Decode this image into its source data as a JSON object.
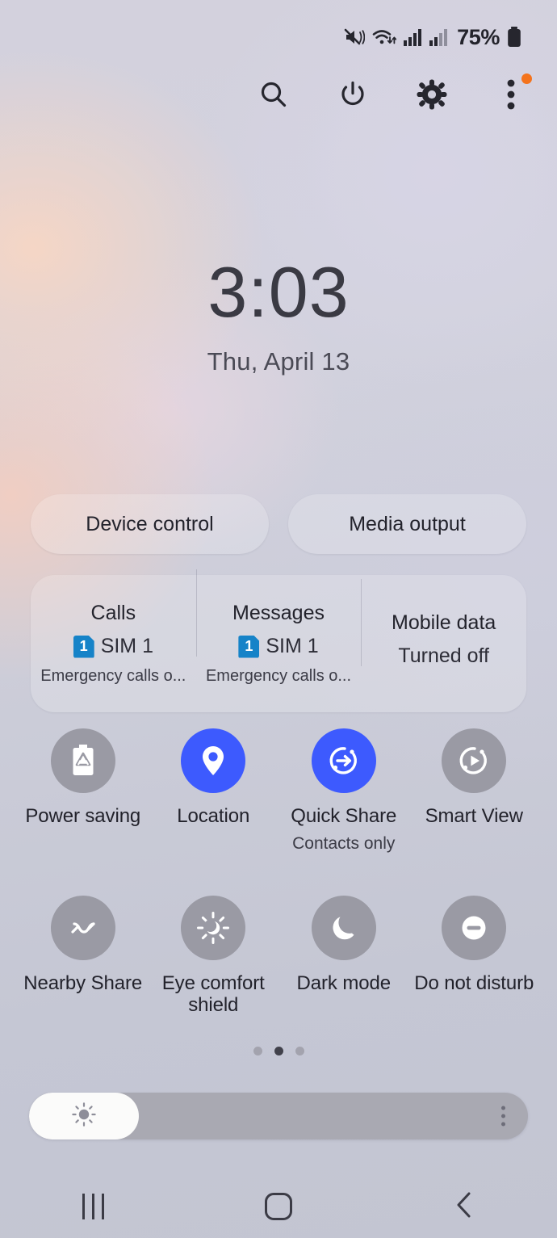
{
  "status_bar": {
    "icons": [
      "mute-vibrate-icon",
      "wifi-icon",
      "signal-sim1-icon",
      "signal-sim2-icon"
    ],
    "battery_percent": "75%",
    "battery_icon": "battery-icon"
  },
  "header": {
    "buttons": [
      {
        "name": "search-button",
        "icon": "search-icon"
      },
      {
        "name": "power-button",
        "icon": "power-icon"
      },
      {
        "name": "settings-button",
        "icon": "gear-icon"
      },
      {
        "name": "more-options-button",
        "icon": "overflow-menu-icon",
        "badge": true
      }
    ],
    "badge_color": "#f4731c"
  },
  "clock": {
    "time": "3:03",
    "date": "Thu, April 13"
  },
  "quick_buttons": [
    {
      "label": "Device control"
    },
    {
      "label": "Media output"
    }
  ],
  "sim_panel": {
    "columns": [
      {
        "title": "Calls",
        "badge": "1",
        "value": "SIM 1",
        "sub": "Emergency calls o..."
      },
      {
        "title": "Messages",
        "badge": "1",
        "value": "SIM 1",
        "sub": "Emergency calls o..."
      },
      {
        "title": "Mobile data",
        "badge": "",
        "value": "Turned off",
        "sub": ""
      }
    ],
    "badge_color": "#1683c8"
  },
  "toggles": {
    "on_color": "#3d5afe",
    "off_color": "#9a9aa4",
    "row1": [
      {
        "label": "Power saving",
        "sub": "",
        "state": "off",
        "icon": "battery-saver-icon"
      },
      {
        "label": "Location",
        "sub": "",
        "state": "on",
        "icon": "location-pin-icon"
      },
      {
        "label": "Quick Share",
        "sub": "Contacts only",
        "state": "on",
        "icon": "quick-share-icon"
      },
      {
        "label": "Smart View",
        "sub": "",
        "state": "off",
        "icon": "smart-view-icon"
      }
    ],
    "row2": [
      {
        "label": "Nearby Share",
        "sub": "",
        "state": "off",
        "icon": "nearby-share-icon"
      },
      {
        "label": "Eye comfort shield",
        "sub": "",
        "state": "off",
        "icon": "sun-icon"
      },
      {
        "label": "Dark mode",
        "sub": "",
        "state": "off",
        "icon": "moon-icon"
      },
      {
        "label": "Do not disturb",
        "sub": "",
        "state": "off",
        "icon": "do-not-disturb-icon"
      }
    ]
  },
  "pager": {
    "count": 3,
    "active_index": 1
  },
  "brightness": {
    "value_percent": 22,
    "thumb_icon": "brightness-sun-icon",
    "menu_icon": "overflow-menu-icon"
  },
  "nav_bar": [
    {
      "name": "recents-button",
      "icon": "recents-icon"
    },
    {
      "name": "home-button",
      "icon": "home-icon"
    },
    {
      "name": "back-button",
      "icon": "back-chevron-icon"
    }
  ]
}
